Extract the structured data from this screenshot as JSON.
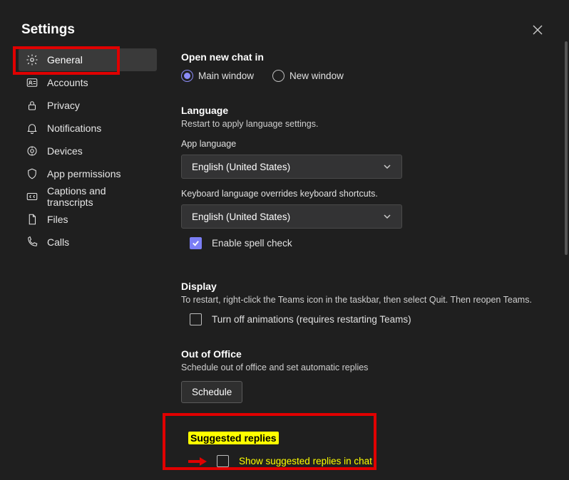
{
  "title": "Settings",
  "sidebar": {
    "items": [
      {
        "label": "General",
        "icon": "gear",
        "active": true
      },
      {
        "label": "Accounts",
        "icon": "idcard"
      },
      {
        "label": "Privacy",
        "icon": "lock"
      },
      {
        "label": "Notifications",
        "icon": "bell"
      },
      {
        "label": "Devices",
        "icon": "devices"
      },
      {
        "label": "App permissions",
        "icon": "shield"
      },
      {
        "label": "Captions and transcripts",
        "icon": "cc"
      },
      {
        "label": "Files",
        "icon": "file"
      },
      {
        "label": "Calls",
        "icon": "phone"
      }
    ]
  },
  "content": {
    "open_new_chat_title": "Open new chat in",
    "radio_main": "Main window",
    "radio_new": "New window",
    "language_title": "Language",
    "language_sub": "Restart to apply language settings.",
    "app_language_label": "App language",
    "app_language_value": "English (United States)",
    "kb_override_label": "Keyboard language overrides keyboard shortcuts.",
    "kb_language_value": "English (United States)",
    "spell_check_label": "Enable spell check",
    "display_title": "Display",
    "display_sub": "To restart, right-click the Teams icon in the taskbar, then select Quit. Then reopen Teams.",
    "turn_off_anim": "Turn off animations (requires restarting Teams)",
    "ooo_title": "Out of Office",
    "ooo_sub": "Schedule out of office and set automatic replies",
    "schedule_btn": "Schedule",
    "suggested_title": "Suggested replies",
    "suggested_check": "Show suggested replies in chat"
  }
}
